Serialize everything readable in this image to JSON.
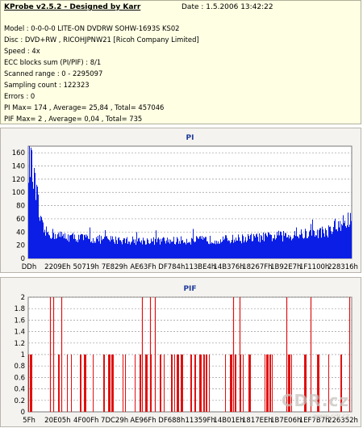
{
  "header": {
    "title": "KProbe v2.5.2 - Designed by Karr",
    "date": "Date : 1.5.2006 13:42:22"
  },
  "info_lines": [
    "Model : 0-0-0-0 LITE-ON DVDRW SOHW-1693S KS02",
    "Disc : DVD+RW , RICOHJPNW21 [Ricoh Company Limited]",
    "Speed : 4x",
    "ECC blocks sum (PI/PIF) : 8/1",
    "Scanned range : 0 - 2295097",
    "Sampling count : 122323",
    "Errors : 0",
    "PI Max= 174 , Average= 25,84 , Total= 457046",
    "PIF Max= 2 , Average= 0,04 , Total= 735"
  ],
  "watermark": {
    "logo": "CDR.cz",
    "url": "www.cdr.cz"
  },
  "colors": {
    "pi_bar": "#0a1ee6",
    "pif_bar": "#e01010",
    "grid": "#9a9a9a",
    "title": "#1f3a9c"
  },
  "chart_data": [
    {
      "type": "bar",
      "title": "PI",
      "ylim": [
        0,
        170
      ],
      "y_ticks": [
        0,
        20,
        40,
        60,
        80,
        100,
        120,
        140,
        160
      ],
      "x_tick_labels": [
        "DDh",
        "2209Eh",
        "50719h",
        "7E829h",
        "AE63Fh",
        "DF784h",
        "113BE4h",
        "14B376h",
        "18267Fh",
        "1B92E7h",
        "1F1100h",
        "228316h"
      ],
      "grid": true,
      "profile": [
        {
          "x": 0.0,
          "y": 150
        },
        {
          "x": 0.005,
          "y": 170
        },
        {
          "x": 0.012,
          "y": 135
        },
        {
          "x": 0.02,
          "y": 110
        },
        {
          "x": 0.028,
          "y": 95
        },
        {
          "x": 0.035,
          "y": 60
        },
        {
          "x": 0.05,
          "y": 42
        },
        {
          "x": 0.1,
          "y": 36
        },
        {
          "x": 0.2,
          "y": 31
        },
        {
          "x": 0.3,
          "y": 29
        },
        {
          "x": 0.4,
          "y": 28
        },
        {
          "x": 0.5,
          "y": 29
        },
        {
          "x": 0.6,
          "y": 30
        },
        {
          "x": 0.7,
          "y": 33
        },
        {
          "x": 0.8,
          "y": 36
        },
        {
          "x": 0.88,
          "y": 40
        },
        {
          "x": 0.94,
          "y": 45
        },
        {
          "x": 0.98,
          "y": 55
        },
        {
          "x": 1.0,
          "y": 65
        }
      ]
    },
    {
      "type": "bar",
      "title": "PIF",
      "ylim": [
        0,
        2
      ],
      "y_ticks": [
        0,
        0.2,
        0.4,
        0.6,
        0.8,
        1,
        1.2,
        1.4,
        1.6,
        1.8,
        2
      ],
      "y_tick_labels": [
        "0",
        "0.2",
        "0.4",
        "0.6",
        "0.8",
        "1",
        "1.2",
        "1.4",
        "1.6",
        "1.8",
        "2"
      ],
      "x_tick_labels": [
        "5Fh",
        "20E05h",
        "4F00Fh",
        "7DC29h",
        "AE96Fh",
        "DF688h",
        "11359Fh",
        "14B01Eh",
        "1817EEh",
        "1B7E06h",
        "1EF7B7h",
        "226352h"
      ],
      "grid": true,
      "values_at_2": [
        0.065,
        0.075,
        0.1,
        0.35,
        0.375,
        0.39,
        0.635,
        0.655,
        0.8,
        0.875,
        0.995
      ]
    }
  ]
}
